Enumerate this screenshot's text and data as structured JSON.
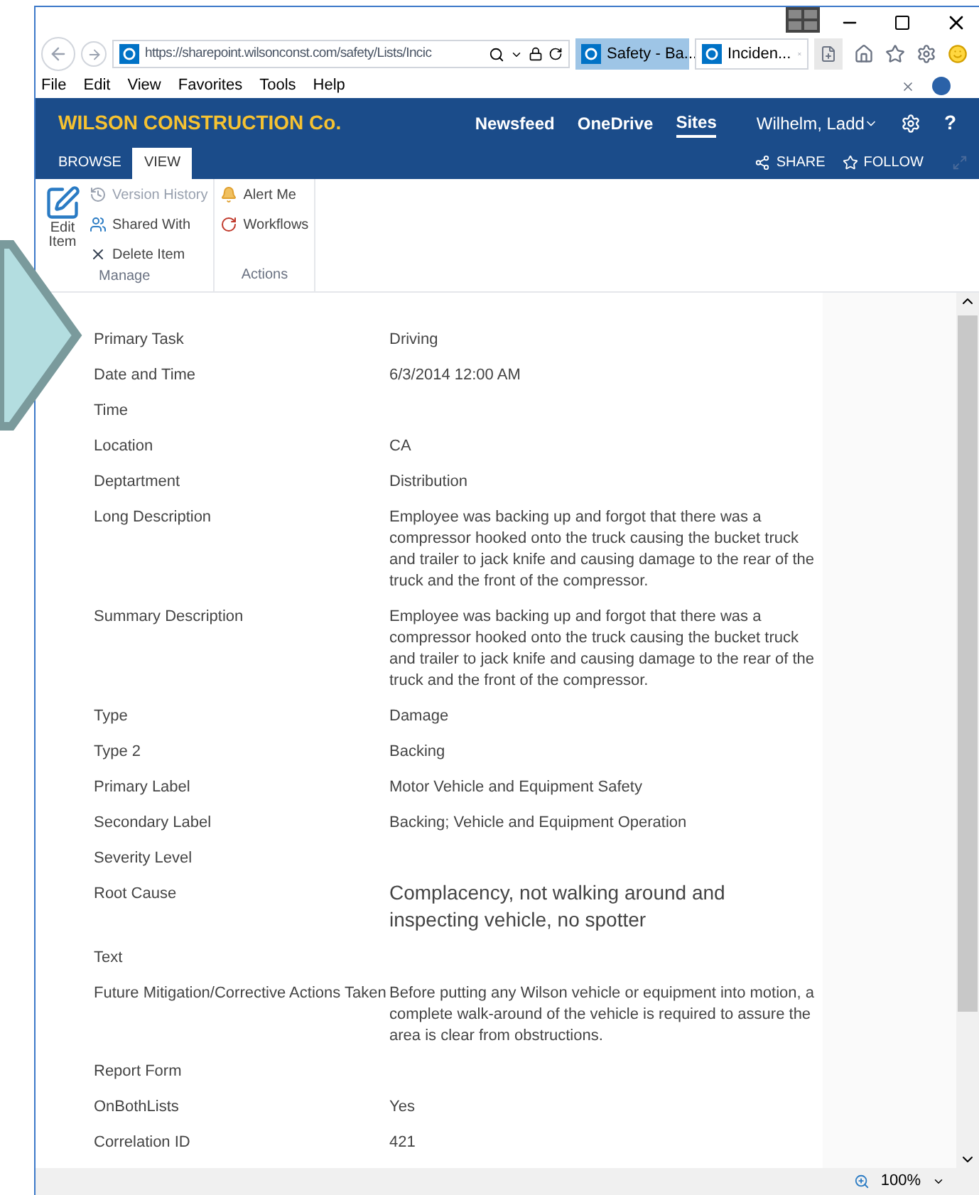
{
  "browser": {
    "url": "https://sharepoint.wilsonconst.com/safety/Lists/Incic",
    "tabs": [
      {
        "label": "Safety - Ba...",
        "selected": false
      },
      {
        "label": "Inciden...",
        "selected": true
      }
    ],
    "menu": [
      "File",
      "Edit",
      "View",
      "Favorites",
      "Tools",
      "Help"
    ],
    "zoom": "100%"
  },
  "suite_bar": {
    "brand": "WILSON CONSTRUCTION Co.",
    "links": [
      {
        "label": "Newsfeed",
        "selected": false
      },
      {
        "label": "OneDrive",
        "selected": false
      },
      {
        "label": "Sites",
        "selected": true
      }
    ],
    "user": "Wilhelm, Ladd",
    "help": "?"
  },
  "ribbon": {
    "tabs": [
      {
        "label": "BROWSE",
        "selected": false
      },
      {
        "label": "VIEW",
        "selected": true
      }
    ],
    "share": "SHARE",
    "follow": "FOLLOW",
    "groups": [
      {
        "name": "Manage",
        "large": {
          "label": "Edit Item"
        },
        "items": [
          {
            "label": "Version History",
            "disabled": true,
            "kind": "history"
          },
          {
            "label": "Shared With",
            "disabled": false,
            "kind": "people"
          },
          {
            "label": "Delete Item",
            "disabled": false,
            "kind": "delete"
          }
        ]
      },
      {
        "name": "Actions",
        "items": [
          {
            "label": "Alert Me",
            "disabled": false,
            "kind": "bell"
          },
          {
            "label": "Workflows",
            "disabled": false,
            "kind": "workflow"
          }
        ]
      }
    ]
  },
  "fields": [
    {
      "label": "Primary Task",
      "value": "Driving"
    },
    {
      "label": "Date and Time",
      "value": "6/3/2014 12:00 AM"
    },
    {
      "label": "Time"
    },
    {
      "label": "Location",
      "value": "CA"
    },
    {
      "label": "Deptartment",
      "value": "Distribution"
    },
    {
      "label": "Long Description",
      "value": "Employee was backing up and forgot that there was a compressor hooked onto the truck causing the bucket truck and trailer to jack knife and causing damage to the rear of the truck and the front of the compressor."
    },
    {
      "label": "Summary Description",
      "value": "Employee was backing up and forgot that there was a compressor hooked onto the truck causing the bucket truck and trailer to jack knife and causing damage to the rear of the truck and the front of the compressor."
    },
    {
      "label": "Type",
      "value": "Damage"
    },
    {
      "label": "Type 2",
      "value": "Backing"
    },
    {
      "label": "Primary Label",
      "value": "Motor Vehicle and Equipment Safety"
    },
    {
      "label": "Secondary Label",
      "value": "Backing; Vehicle and Equipment Operation"
    },
    {
      "label": "Severity Level"
    },
    {
      "label": "Root Cause",
      "value": "Complacency, not walking around and inspecting vehicle, no spotter",
      "kind": "large"
    },
    {
      "label": "Text"
    },
    {
      "label": "Future Mitigation/Corrective Actions Taken",
      "value": "Before putting any Wilson vehicle or equipment into motion, a complete walk-around of the vehicle is required to assure the area is clear from obstructions."
    },
    {
      "label": "Report Form"
    },
    {
      "label": "OnBothLists",
      "value": "Yes"
    },
    {
      "label": "Correlation ID",
      "value": "421"
    }
  ]
}
